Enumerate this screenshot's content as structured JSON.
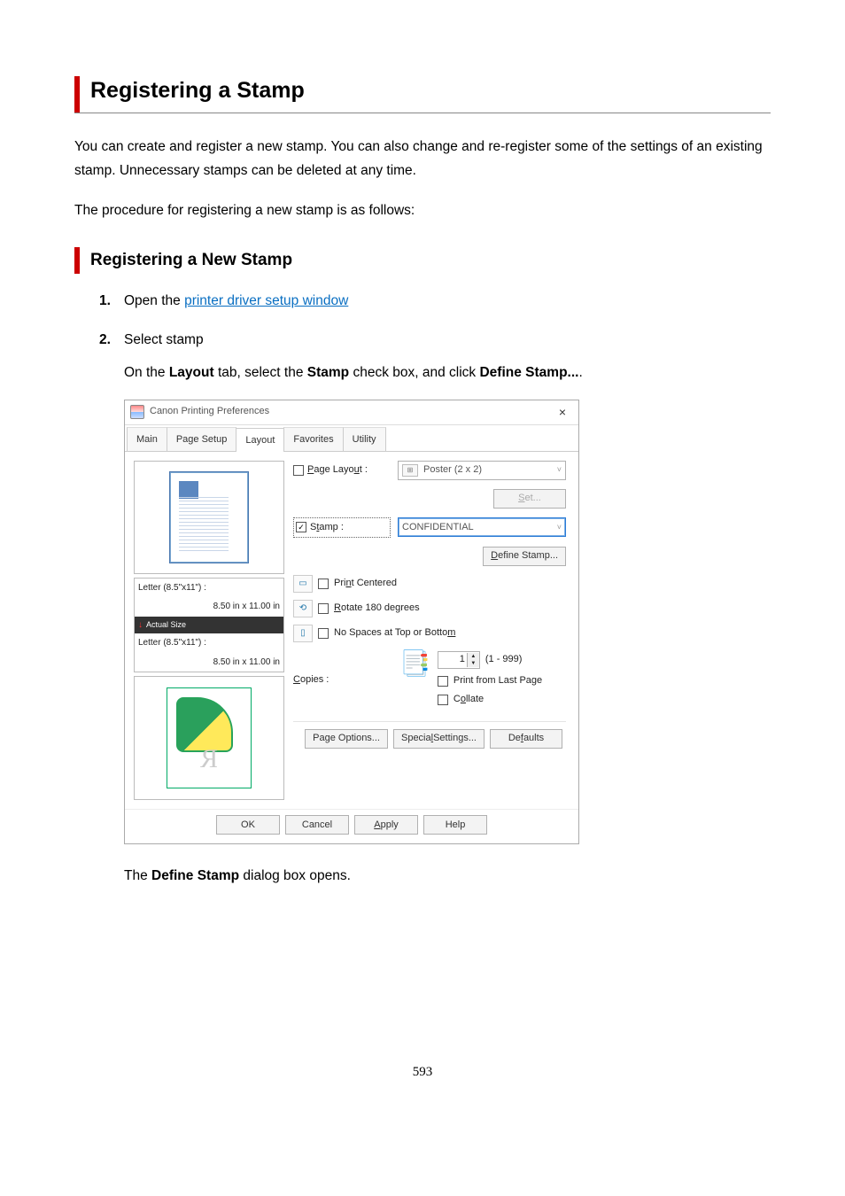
{
  "heading": "Registering a Stamp",
  "intro1": "You can create and register a new stamp. You can also change and re-register some of the settings of an existing stamp. Unnecessary stamps can be deleted at any time.",
  "intro2": "The procedure for registering a new stamp is as follows:",
  "subheading": "Registering a New Stamp",
  "steps": {
    "s1": {
      "num": "1.",
      "text_before": "Open the ",
      "link": "printer driver setup window"
    },
    "s2": {
      "num": "2.",
      "title": "Select stamp",
      "instr_before": "On the ",
      "instr_bold1": "Layout",
      "instr_mid1": " tab, select the ",
      "instr_bold2": "Stamp",
      "instr_mid2": " check box, and click ",
      "instr_bold3": "Define Stamp...",
      "instr_after": ".",
      "closing_before": "The ",
      "closing_bold": "Define Stamp",
      "closing_after": " dialog box opens."
    }
  },
  "dialog": {
    "title": "Canon             Printing Preferences",
    "close": "×",
    "tabs": [
      "Main",
      "Page Setup",
      "Layout",
      "Favorites",
      "Utility"
    ],
    "page_layout_label": "Page Layout :",
    "page_layout_value": "Poster (2 x 2)",
    "set_btn": "Set...",
    "stamp_label": "Stamp :",
    "stamp_value": "CONFIDENTIAL",
    "define_stamp_btn": "Define Stamp...",
    "info_top_label": "Letter (8.5\"x11\") :",
    "info_top_dim": "8.50 in x 11.00 in",
    "info_sep": "Actual Size",
    "info_bot_label": "Letter (8.5\"x11\") :",
    "info_bot_dim": "8.50 in x 11.00 in",
    "opt_centered": "Print Centered",
    "opt_rotate": "Rotate 180 degrees",
    "opt_nospace": "No Spaces at Top or Bottom",
    "copies_label": "Copies :",
    "copies_value": "1",
    "copies_range": "(1 - 999)",
    "opt_lastpage": "Print from Last Page",
    "opt_collate": "Collate",
    "btn_page_options": "Page Options...",
    "btn_special": "Special Settings...",
    "btn_defaults": "Defaults",
    "btn_ok": "OK",
    "btn_cancel": "Cancel",
    "btn_apply": "Apply",
    "btn_help": "Help",
    "stamp_preview_letter": "R"
  },
  "page_number": "593"
}
